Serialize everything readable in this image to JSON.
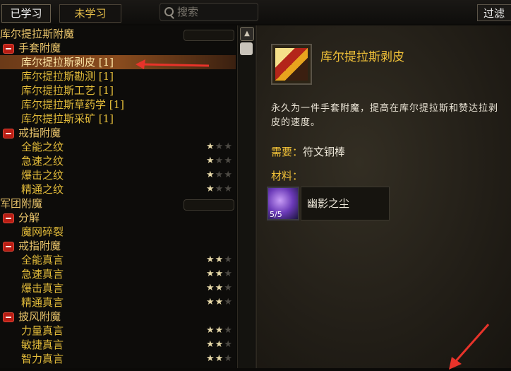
{
  "tabs": {
    "learned": "已学习",
    "unlearned": "未学习"
  },
  "search": {
    "placeholder": "搜索"
  },
  "filter_label": "过滤",
  "list": [
    {
      "kind": "header",
      "text": "库尔提拉斯附魔",
      "catbar": true
    },
    {
      "kind": "sub",
      "text": "手套附魔"
    },
    {
      "kind": "recipe",
      "text": "库尔提拉斯剥皮 [1]",
      "selected": true
    },
    {
      "kind": "recipe",
      "text": "库尔提拉斯勘测 [1]"
    },
    {
      "kind": "recipe",
      "text": "库尔提拉斯工艺 [1]"
    },
    {
      "kind": "recipe",
      "text": "库尔提拉斯草药学 [1]"
    },
    {
      "kind": "recipe",
      "text": "库尔提拉斯采矿 [1]"
    },
    {
      "kind": "sub",
      "text": "戒指附魔"
    },
    {
      "kind": "recipe",
      "text": "全能之纹",
      "stars": 1
    },
    {
      "kind": "recipe",
      "text": "急速之纹",
      "stars": 1
    },
    {
      "kind": "recipe",
      "text": "爆击之纹",
      "stars": 1
    },
    {
      "kind": "recipe",
      "text": "精通之纹",
      "stars": 1
    },
    {
      "kind": "header",
      "text": "军团附魔",
      "catbar": true
    },
    {
      "kind": "sub",
      "text": "分解"
    },
    {
      "kind": "recipe",
      "text": "魔网碎裂"
    },
    {
      "kind": "sub",
      "text": "戒指附魔"
    },
    {
      "kind": "recipe",
      "text": "全能真言",
      "stars": 2
    },
    {
      "kind": "recipe",
      "text": "急速真言",
      "stars": 2
    },
    {
      "kind": "recipe",
      "text": "爆击真言",
      "stars": 2
    },
    {
      "kind": "recipe",
      "text": "精通真言",
      "stars": 2
    },
    {
      "kind": "sub",
      "text": "披风附魔"
    },
    {
      "kind": "recipe",
      "text": "力量真言",
      "stars": 2
    },
    {
      "kind": "recipe",
      "text": "敏捷真言",
      "stars": 2
    },
    {
      "kind": "recipe",
      "text": "智力真言",
      "stars": 2
    }
  ],
  "detail": {
    "title": "库尔提拉斯剥皮",
    "description": "永久为一件手套附魔，提高在库尔提拉斯和赞达拉剥皮的速度。",
    "requires_label": "需要：",
    "requires_value": "符文铜棒",
    "materials_label": "材料：",
    "material": {
      "name": "幽影之尘",
      "count": "5/5"
    }
  },
  "colors": {
    "accent": "#f0c038",
    "selected_row": "#8a4c1e",
    "arrow": "#e8332a"
  }
}
